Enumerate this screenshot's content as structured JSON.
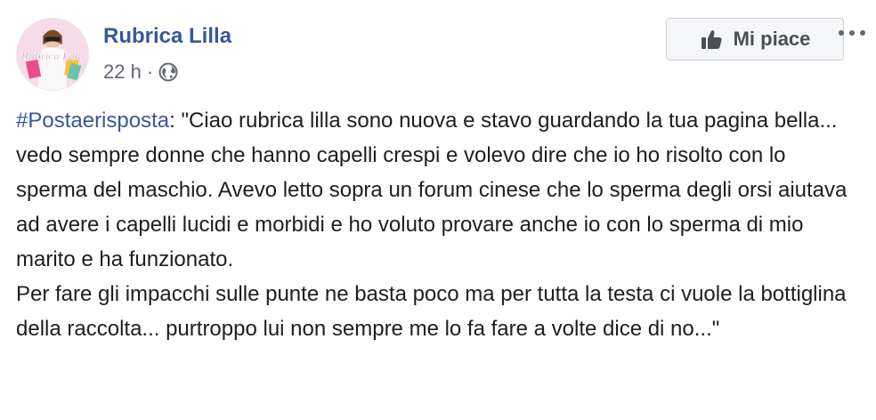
{
  "post": {
    "page_name": "Rubrica Lilla",
    "time": "22 h",
    "separator": "·",
    "privacy_icon": "globe-icon",
    "avatar_text": "Rubrica Lilla",
    "like_label": "Mi piace",
    "like_icon": "thumbs-up-icon",
    "more_icon": "ellipsis-icon",
    "hashtag": "#Postaerisposta",
    "paragraph1_rest": ": \"Ciao rubrica lilla sono nuova e stavo guardando la tua pagina bella... vedo sempre donne che hanno capelli crespi e volevo dire che io ho risolto con lo sperma del maschio. Avevo letto sopra un forum cinese che lo sperma degli orsi aiutava ad avere i capelli lucidi e morbidi e ho voluto provare anche io con lo sperma di mio marito e ha funzionato.",
    "paragraph2": "Per fare gli impacchi sulle punte ne basta poco ma per tutta la testa ci vuole la bottiglina della raccolta... purtroppo lui non sempre me lo fa fare a volte dice di no...\""
  },
  "colors": {
    "link": "#385898",
    "meta_text": "#606770",
    "body_text": "#1c1e21",
    "button_bg": "#f5f6f7",
    "button_border": "#ccd0d5"
  }
}
